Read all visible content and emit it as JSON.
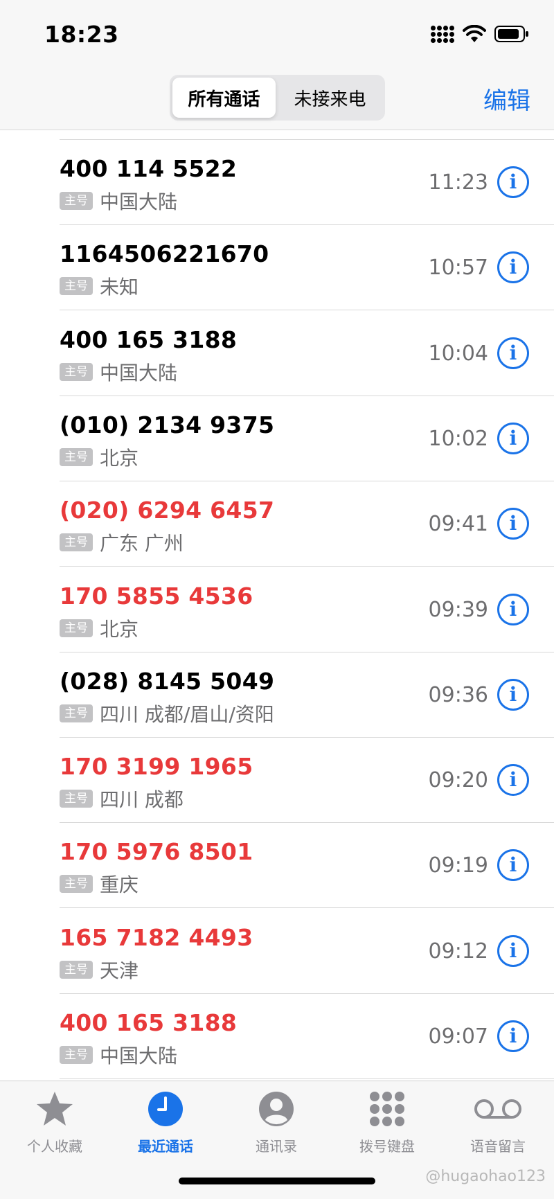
{
  "status": {
    "time": "18:23"
  },
  "header": {
    "tabs": [
      "所有通话",
      "未接来电"
    ],
    "edit_label": "编辑"
  },
  "colors": {
    "accent": "#1a73e8",
    "missed": "#e8393a",
    "secondary": "#6d6d6f"
  },
  "calls": [
    {
      "number": "400 114 5522",
      "label": "主号",
      "location": "中国大陆",
      "time": "11:23",
      "missed": false
    },
    {
      "number": "1164506221670",
      "label": "主号",
      "location": "未知",
      "time": "10:57",
      "missed": false
    },
    {
      "number": "400 165 3188",
      "label": "主号",
      "location": "中国大陆",
      "time": "10:04",
      "missed": false
    },
    {
      "number": "(010) 2134 9375",
      "label": "主号",
      "location": "北京",
      "time": "10:02",
      "missed": false
    },
    {
      "number": "(020) 6294 6457",
      "label": "主号",
      "location": "广东 广州",
      "time": "09:41",
      "missed": true
    },
    {
      "number": "170 5855 4536",
      "label": "主号",
      "location": "北京",
      "time": "09:39",
      "missed": true
    },
    {
      "number": "(028) 8145 5049",
      "label": "主号",
      "location": "四川 成都/眉山/资阳",
      "time": "09:36",
      "missed": false
    },
    {
      "number": "170 3199 1965",
      "label": "主号",
      "location": "四川 成都",
      "time": "09:20",
      "missed": true
    },
    {
      "number": "170 5976 8501",
      "label": "主号",
      "location": "重庆",
      "time": "09:19",
      "missed": true
    },
    {
      "number": "165 7182 4493",
      "label": "主号",
      "location": "天津",
      "time": "09:12",
      "missed": true
    },
    {
      "number": "400 165 3188",
      "label": "主号",
      "location": "中国大陆",
      "time": "09:07",
      "missed": true
    }
  ],
  "info_glyph": "i",
  "tabbar": {
    "items": [
      {
        "label": "个人收藏",
        "icon": "star-icon"
      },
      {
        "label": "最近通话",
        "icon": "clock-icon"
      },
      {
        "label": "通讯录",
        "icon": "contact-icon"
      },
      {
        "label": "拨号键盘",
        "icon": "keypad-icon"
      },
      {
        "label": "语音留言",
        "icon": "voicemail-icon"
      }
    ],
    "active_index": 1
  },
  "watermark": "@hugaohao123"
}
